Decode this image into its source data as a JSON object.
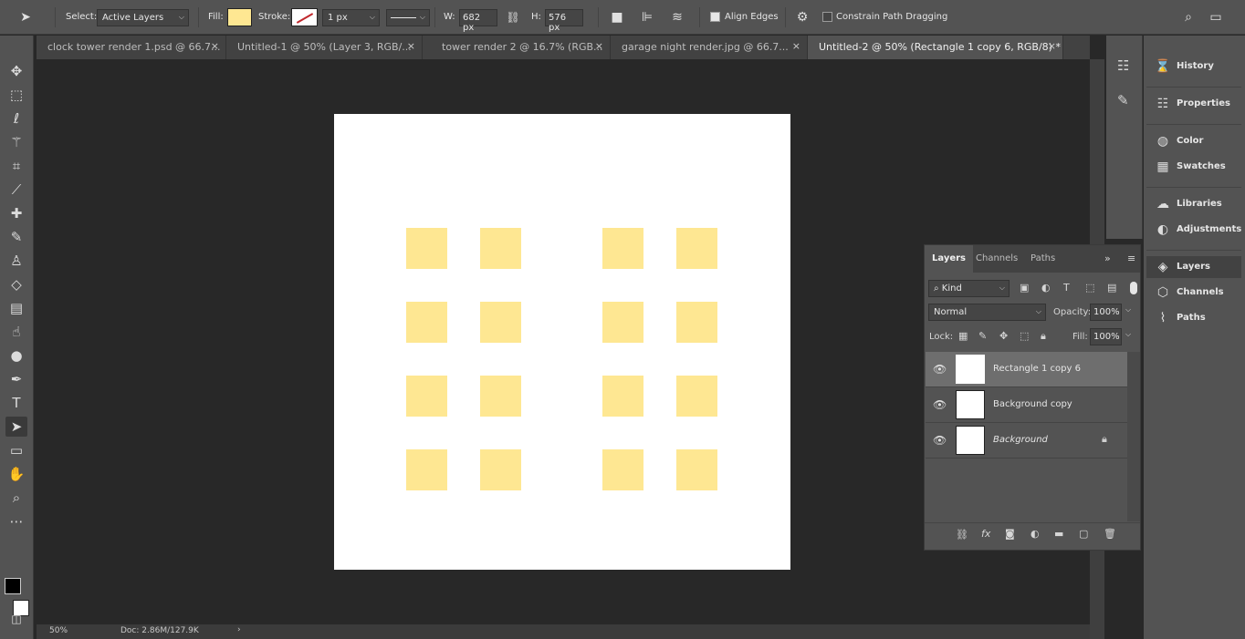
{
  "options_bar": {
    "select_label": "Select:",
    "select_value": "Active Layers",
    "fill_label": "Fill:",
    "fill_color": "#fee792",
    "stroke_label": "Stroke:",
    "stroke_width": "1 px",
    "width_label": "W:",
    "width_value": "682 px",
    "height_label": "H:",
    "height_value": "576 px",
    "align_edges_label": "Align Edges",
    "align_edges_checked": true,
    "constrain_label": "Constrain Path Dragging",
    "constrain_checked": false
  },
  "tabs": [
    {
      "label": "clock tower render 1.psd @ 66.7...",
      "active": false
    },
    {
      "label": "Untitled-1 @ 50% (Layer 3, RGB/...",
      "active": false
    },
    {
      "label": "tower render 2 @ 16.7% (RGB...",
      "active": false
    },
    {
      "label": "garage night render.jpg @ 66.7...",
      "active": false
    },
    {
      "label": "Untitled-2 @ 50% (Rectangle 1 copy 6, RGB/8) *",
      "active": true
    }
  ],
  "tab_close_glyph": "×",
  "tools": [
    "move-tool",
    "marquee-tool",
    "lasso-tool",
    "magic-wand-tool",
    "crop-tool",
    "eyedropper-tool",
    "healing-brush-tool",
    "brush-tool",
    "clone-stamp-tool",
    "eraser-tool",
    "gradient-tool",
    "smudge-tool",
    "dodge-tool",
    "pen-tool",
    "type-tool",
    "path-selection-tool",
    "rectangle-tool",
    "hand-tool",
    "zoom-tool",
    "more-tools"
  ],
  "active_tool": "path-selection-tool",
  "canvas": {
    "document_color": "#ffffff",
    "square_color": "#fee792"
  },
  "status": {
    "zoom": "50%",
    "doc": "Doc: 2.86M/127.9K"
  },
  "right_panels": [
    {
      "label": "History",
      "icon": "history-icon"
    },
    {
      "label": "Properties",
      "icon": "properties-icon"
    },
    {
      "label": "Color",
      "icon": "color-icon"
    },
    {
      "label": "Swatches",
      "icon": "swatches-icon"
    },
    {
      "label": "Libraries",
      "icon": "libraries-icon"
    },
    {
      "label": "Adjustments",
      "icon": "adjustments-icon"
    },
    {
      "label": "Layers",
      "icon": "layers-icon",
      "active": true
    },
    {
      "label": "Channels",
      "icon": "channels-icon"
    },
    {
      "label": "Paths",
      "icon": "paths-icon"
    }
  ],
  "layers_panel": {
    "tabs": [
      "Layers",
      "Channels",
      "Paths"
    ],
    "active_tab": "Layers",
    "filter_label": "Kind",
    "blend_mode": "Normal",
    "opacity_label": "Opacity:",
    "opacity_value": "100%",
    "lock_label": "Lock:",
    "fill_label": "Fill:",
    "fill_value": "100%",
    "layers": [
      {
        "name": "Rectangle 1 copy 6",
        "selected": true,
        "locked": false,
        "italic": false
      },
      {
        "name": "Background copy",
        "selected": false,
        "locked": false,
        "italic": false
      },
      {
        "name": "Background",
        "selected": false,
        "locked": true,
        "italic": true
      }
    ]
  }
}
